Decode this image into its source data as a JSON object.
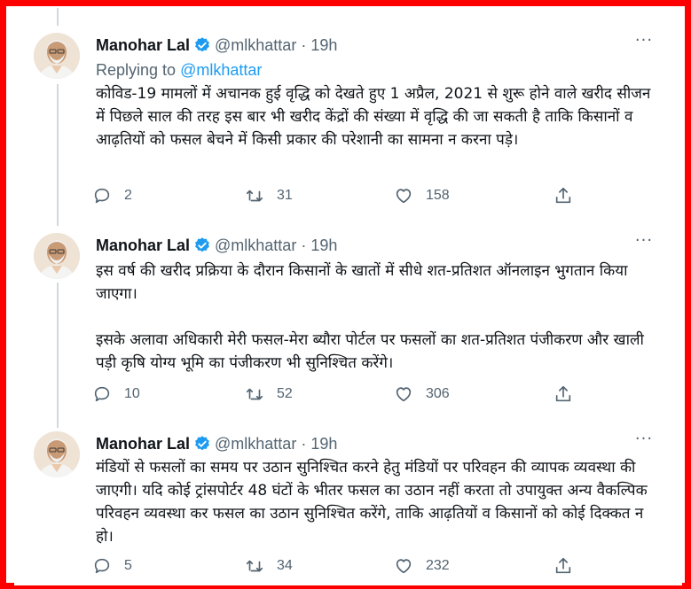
{
  "author": {
    "name": "Manohar Lal",
    "handle": "@mlkhattar",
    "time": "19h"
  },
  "tweets": [
    {
      "replying_prefix": "Replying to",
      "replying_handle": "@mlkhattar",
      "paragraphs": [
        "कोविड-19 मामलों में अचानक हुई वृद्धि को देखते हुए 1 अप्रैल, 2021 से शुरू होने वाले खरीद सीजन में पिछले साल की तरह इस बार भी खरीद केंद्रों की संख्या में वृद्धि की जा सकती है ताकि किसानों व आढ़तियों को फसल बेचने में किसी प्रकार की परेशानी का सामना न करना पड़े।"
      ],
      "replies": "2",
      "retweets": "31",
      "likes": "158"
    },
    {
      "paragraphs": [
        "इस वर्ष की खरीद प्रक्रिया के दौरान किसानों के खातों में सीधे शत-प्रतिशत ऑनलाइन भुगतान किया जाएगा।",
        "इसके अलावा अधिकारी मेरी फसल-मेरा ब्यौरा पोर्टल पर फसलों का शत-प्रतिशत पंजीकरण और खाली पड़ी कृषि योग्य भूमि का पंजीकरण भी सुनिश्चित करेंगे।"
      ],
      "replies": "10",
      "retweets": "52",
      "likes": "306"
    },
    {
      "paragraphs": [
        "मंडियों से फसलों का समय पर उठान सुनिश्चित करने हेतु मंडियों पर परिवहन की व्यापक व्यवस्था की जाएगी। यदि कोई ट्रांसपोर्टर 48 घंटों के भीतर फसल का उठान नहीं करता तो उपायुक्त अन्य वैकल्पिक परिवहन व्यवस्था कर फसल का उठान सुनिश्चित करेंगे, ताकि आढ़तियों व किसानों को कोई दिक्कत न हो।"
      ],
      "replies": "5",
      "retweets": "34",
      "likes": "232"
    }
  ],
  "icons": {
    "reply": "reply-icon",
    "retweet": "retweet-icon",
    "like": "heart-icon",
    "share": "share-icon",
    "more": "more-icon",
    "verified": "verified-badge-icon"
  },
  "colors": {
    "frame": "#ff0000",
    "verified": "#1d9bf0",
    "link": "#1d9bf0",
    "muted": "#536471",
    "text": "#0f1419"
  }
}
